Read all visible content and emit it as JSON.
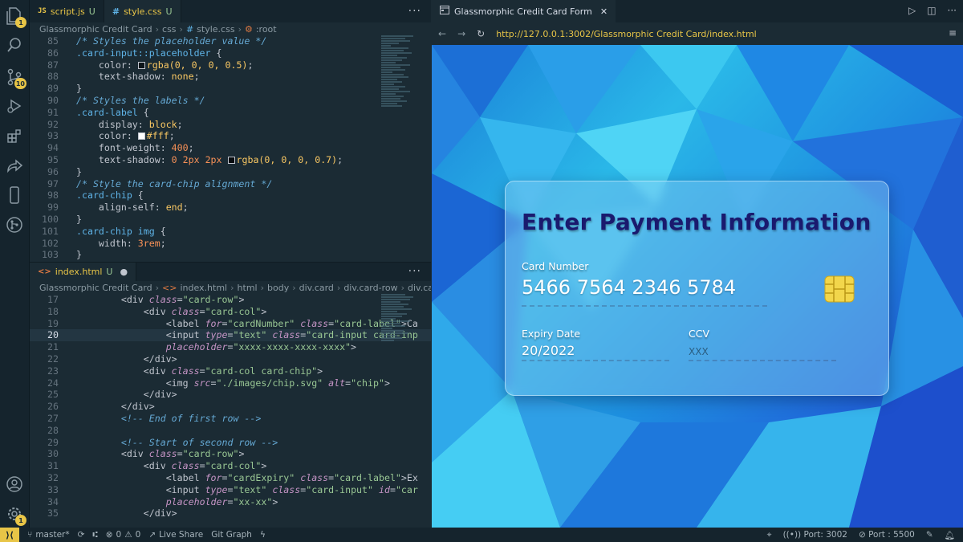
{
  "activity_bar": {
    "explorer_badge": "1",
    "scm_badge": "10",
    "settings_badge": "1"
  },
  "top_editor": {
    "tabs": [
      {
        "icon": "JS",
        "label": "script.js",
        "status": "U"
      },
      {
        "icon": "#",
        "label": "style.css",
        "status": "U"
      }
    ],
    "breadcrumb": [
      "Glassmorphic Credit Card",
      "css",
      "#",
      "style.css",
      ":root"
    ],
    "lines": [
      {
        "n": "85"
      },
      {
        "n": "86"
      },
      {
        "n": "87"
      },
      {
        "n": "88"
      },
      {
        "n": "89"
      },
      {
        "n": "90"
      },
      {
        "n": "91"
      },
      {
        "n": "92"
      },
      {
        "n": "93"
      },
      {
        "n": "94"
      },
      {
        "n": "95"
      },
      {
        "n": "96"
      },
      {
        "n": "97"
      },
      {
        "n": "98"
      },
      {
        "n": "99"
      },
      {
        "n": "100"
      },
      {
        "n": "101"
      },
      {
        "n": "102"
      },
      {
        "n": "103"
      }
    ],
    "code": {
      "l85": "/* Styles the placeholder value */",
      "l86_sel": ".card-input::placeholder",
      "l87_prop": "color: ",
      "l87_val": "rgba(0, 0, 0, 0.5)",
      "l88_prop": "text-shadow: ",
      "l88_val": "none",
      "l90": "/* Styles the labels */",
      "l91_sel": ".card-label",
      "l92_prop": "display: ",
      "l92_val": "block",
      "l93_prop": "color: ",
      "l93_val": "#fff",
      "l94_prop": "font-weight: ",
      "l94_val": "400",
      "l95_prop": "text-shadow: ",
      "l95_a": "0 ",
      "l95_b": "2px",
      "l95_c": " 2px ",
      "l95_d": "rgba(0, 0, 0, 0.7)",
      "l97": "/* Style the card-chip alignment */",
      "l98_sel": ".card-chip",
      "l99_prop": "align-self: ",
      "l99_val": "end",
      "l101_sel": ".card-chip img",
      "l102_prop": "width: ",
      "l102_val": "3rem"
    }
  },
  "bottom_editor": {
    "tab": {
      "label": "index.html",
      "status": "U"
    },
    "breadcrumb": [
      "Glassmorphic Credit Card",
      "index.html",
      "html",
      "body",
      "div.card",
      "div.card-row",
      "div.ca"
    ],
    "lines": [
      {
        "n": "17"
      },
      {
        "n": "18"
      },
      {
        "n": "19"
      },
      {
        "n": "20"
      },
      {
        "n": "21"
      },
      {
        "n": "22"
      },
      {
        "n": "23"
      },
      {
        "n": "24"
      },
      {
        "n": "25"
      },
      {
        "n": "26"
      },
      {
        "n": "27"
      },
      {
        "n": "28"
      },
      {
        "n": "29"
      },
      {
        "n": "30"
      },
      {
        "n": "31"
      },
      {
        "n": "32"
      },
      {
        "n": "33"
      },
      {
        "n": "34"
      },
      {
        "n": "35"
      }
    ],
    "code": {
      "l27": "<!-- End of first row -->",
      "l29": "<!-- Start of second row -->",
      "cardNumber": "\"cardNumber\"",
      "card_label": "\"card-label\"",
      "Ca": ">Ca",
      "text": "\"text\"",
      "card_input_inp": "\"card-input card-inp",
      "ph1": "\"xxxx-xxxx-xxxx-xxxx\"",
      "card_row": "\"card-row\"",
      "card_col": "\"card-col\"",
      "card_col_chip": "\"card-col card-chip\"",
      "chip_src": "\"./images/chip.svg\"",
      "chip_alt": "\"chip\"",
      "cardExpiry": "\"cardExpiry\"",
      "Ex": ">Ex",
      "card_input": "\"card-input\"",
      "car": "\"car",
      "ph2": "\"xx-xx\""
    }
  },
  "browser": {
    "tab_title": "Glassmorphic Credit Card Form",
    "url": "http://127.0.0.1:3002/Glassmorphic Credit Card/index.html"
  },
  "card": {
    "title": "Enter Payment Information",
    "card_number_label": "Card Number",
    "card_number_value": "5466 7564 2346 5784",
    "expiry_label": "Expiry Date",
    "expiry_value": "20/2022",
    "ccv_label": "CCV",
    "ccv_placeholder": "XXX"
  },
  "status_bar": {
    "branch": "master*",
    "errors": "0",
    "warnings": "0",
    "live_share": "Live Share",
    "git_graph": "Git Graph",
    "port1": "Port: 3002",
    "port2": "Port : 5500"
  },
  "colors": {
    "accent": "#e8c547",
    "background": "#1b2b34",
    "card_title": "#1a1a6e"
  }
}
